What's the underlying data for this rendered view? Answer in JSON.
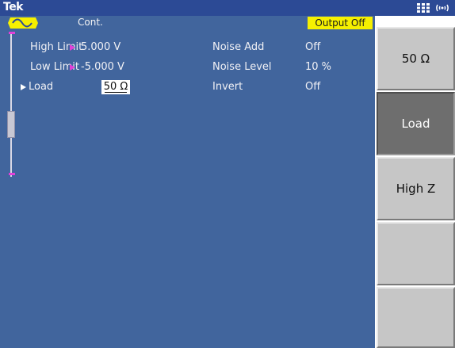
{
  "header": {
    "brand": "Tek",
    "icons": [
      "grid-icon",
      "wireless-icon"
    ]
  },
  "status": {
    "mode": "Cont.",
    "output_state": "Output Off",
    "wave_icon": "sine-wave-icon"
  },
  "parameters": [
    {
      "name": "High Limit",
      "value": "5.000 V"
    },
    {
      "name": "Low Limit",
      "value": "-5.000 V"
    },
    {
      "name": "Load",
      "value": "50 Ω",
      "selected": true
    }
  ],
  "parameters_right": [
    {
      "name": "Noise Add",
      "value": "Off"
    },
    {
      "name": "Noise Level",
      "value": "10 %"
    },
    {
      "name": "Invert",
      "value": "Off"
    }
  ],
  "softkeys": [
    {
      "label": "50 Ω",
      "active": false
    },
    {
      "label": "Load",
      "active": true
    },
    {
      "label": "High Z",
      "active": false
    },
    {
      "label": "",
      "active": false
    },
    {
      "label": "",
      "active": false
    }
  ],
  "colors": {
    "header_bg": "#2c4a95",
    "main_bg": "#41659d",
    "output_badge_bg": "#f6f000",
    "marker": "#e040d8",
    "softkey_bg": "#c6c6c6",
    "softkey_active_bg": "#6e6e6e"
  }
}
